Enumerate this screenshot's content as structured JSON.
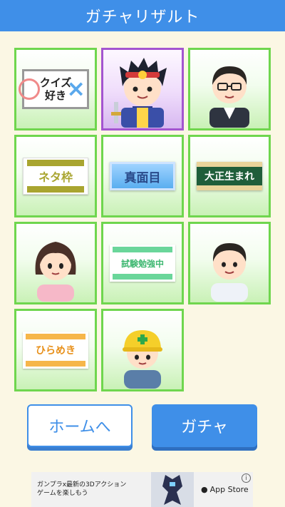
{
  "header": {
    "title": "ガチャリザルト"
  },
  "cards": {
    "quiz": {
      "line1": "クイズ",
      "line2": "好き"
    },
    "neta": "ネタ枠",
    "majime": "真面目",
    "taisho": "大正生まれ",
    "study": "試験勉強中",
    "hirameki": "ひらめき"
  },
  "buttons": {
    "home": "ホームへ",
    "gacha": "ガチャ"
  },
  "ad": {
    "text": "ガンプラx最新の3Dアクションゲームを楽しもう",
    "store": "App Store",
    "info": "i"
  },
  "icons": [
    "apple-icon",
    "info-icon"
  ],
  "colors": {
    "header": "#3f8fe8",
    "card_border": "#6fd64e",
    "rare_border": "#a455d0",
    "background": "#fbf7e4"
  }
}
